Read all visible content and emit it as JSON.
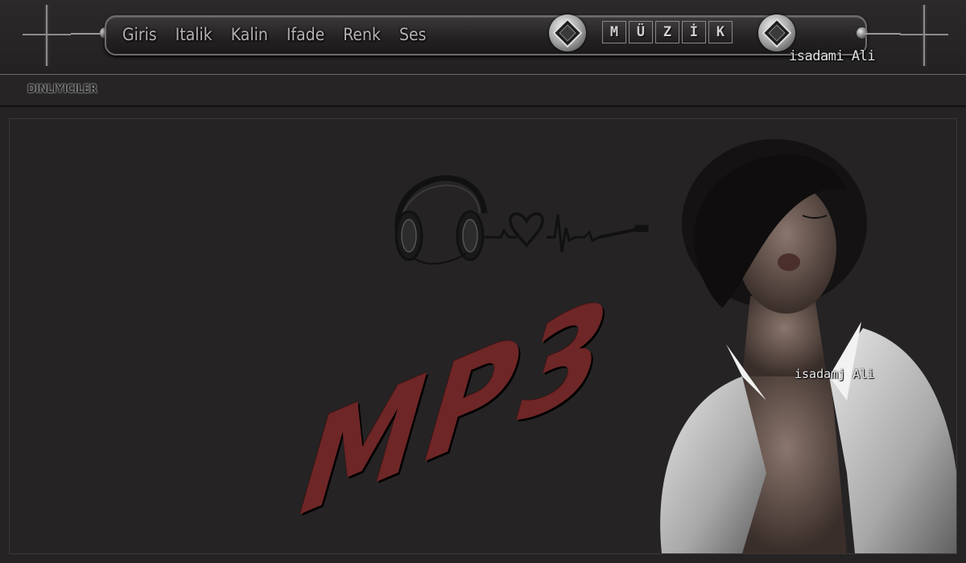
{
  "nav": {
    "links": [
      "Giris",
      "Italik",
      "Kalin",
      "Ifade",
      "Renk",
      "Ses"
    ]
  },
  "music_letters": [
    "M",
    "Ü",
    "Z",
    "İ",
    "K"
  ],
  "brand_signature": "isadami Ali",
  "subbar": {
    "listeners_label": "DINLIYICILER"
  },
  "main": {
    "logo_text": "MP3",
    "portrait_signature": "isadamj Ali"
  },
  "colors": {
    "background": "#252324",
    "accent_red": "#6e2626",
    "text_light": "#b6b2b2"
  },
  "icons": {
    "headphones": "headphones-icon",
    "heart": "heart-icon",
    "diamond": "diamond-icon"
  }
}
